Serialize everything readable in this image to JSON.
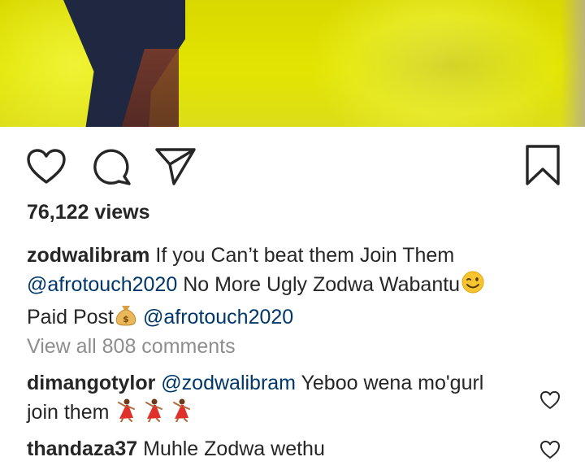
{
  "post": {
    "views": "76,122 views",
    "caption": {
      "username": "zodwalibram",
      "text1": "If you Can’t beat them Join Them",
      "mention1": "@afrotouch2020",
      "text2": "No More Ugly Zodwa Wabantu",
      "emoji1": "winking-face",
      "text3": "Paid Post",
      "emoji2": "money-bag",
      "mention2": "@afrotouch2020"
    },
    "view_all_comments": "View all 808 comments"
  },
  "comments": [
    {
      "username": "dimangotylor",
      "mention": "@zodwalibram",
      "text": "Yeboo wena mo'gurl",
      "text2": "join them",
      "emoji": "dancing-woman",
      "emoji_count": 3
    },
    {
      "username": "thandaza37",
      "text": "Muhle Zodwa wethu"
    }
  ],
  "icons": {
    "like": "heart-icon",
    "comment": "comment-icon",
    "share": "paper-plane-icon",
    "save": "bookmark-icon"
  },
  "colors": {
    "text": "#262626",
    "link": "#00376b",
    "muted": "#8e8e8e"
  }
}
